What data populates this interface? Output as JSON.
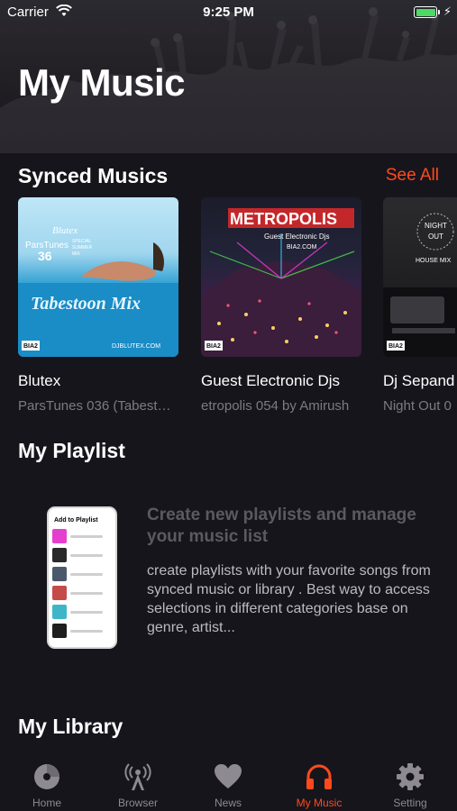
{
  "status_bar": {
    "carrier": "Carrier",
    "time": "9:25 PM"
  },
  "header": {
    "title": "My Music"
  },
  "synced": {
    "title": "Synced Musics",
    "see_all": "See All",
    "items": [
      {
        "title": "Blutex",
        "subtitle": "ParsTunes 036 (Tabest…",
        "cover_texts": [
          "Blutex",
          "ParsTunes",
          "36",
          "SPECIAL",
          "SUMMER",
          "MIX",
          "Tabestoon Mix",
          "DJBLUTEX.COM",
          "BIA2"
        ]
      },
      {
        "title": "Guest Electronic Djs",
        "subtitle": "etropolis 054 by Amirush",
        "cover_texts": [
          "METROPOLIS",
          "Guest Electronic Djs",
          "BIA2.COM",
          "BIA2"
        ]
      },
      {
        "title": "Dj Sepand",
        "subtitle": "Night Out 0",
        "cover_texts": [
          "NIGHT",
          "OUT",
          "HOUSE MIX",
          "BIA2"
        ]
      }
    ]
  },
  "playlist": {
    "title": "My Playlist",
    "promo_title": "Create new playlists and manage your music list",
    "promo_text": "create playlists with your favorite songs from synced music or library . Best way to access selections in different categories base on genre, artist...",
    "phone_header": "Add to Playlist"
  },
  "library": {
    "title": "My Library"
  },
  "tabs": [
    {
      "label": "Home",
      "icon": "disc-icon"
    },
    {
      "label": "Browser",
      "icon": "antenna-icon"
    },
    {
      "label": "News",
      "icon": "heart-icon"
    },
    {
      "label": "My Music",
      "icon": "headphones-icon"
    },
    {
      "label": "Setting",
      "icon": "gear-icon"
    }
  ],
  "colors": {
    "accent": "#ff4a1c",
    "background": "#17151c",
    "inactive_tab": "#8d8b91",
    "battery": "#4cd964"
  }
}
